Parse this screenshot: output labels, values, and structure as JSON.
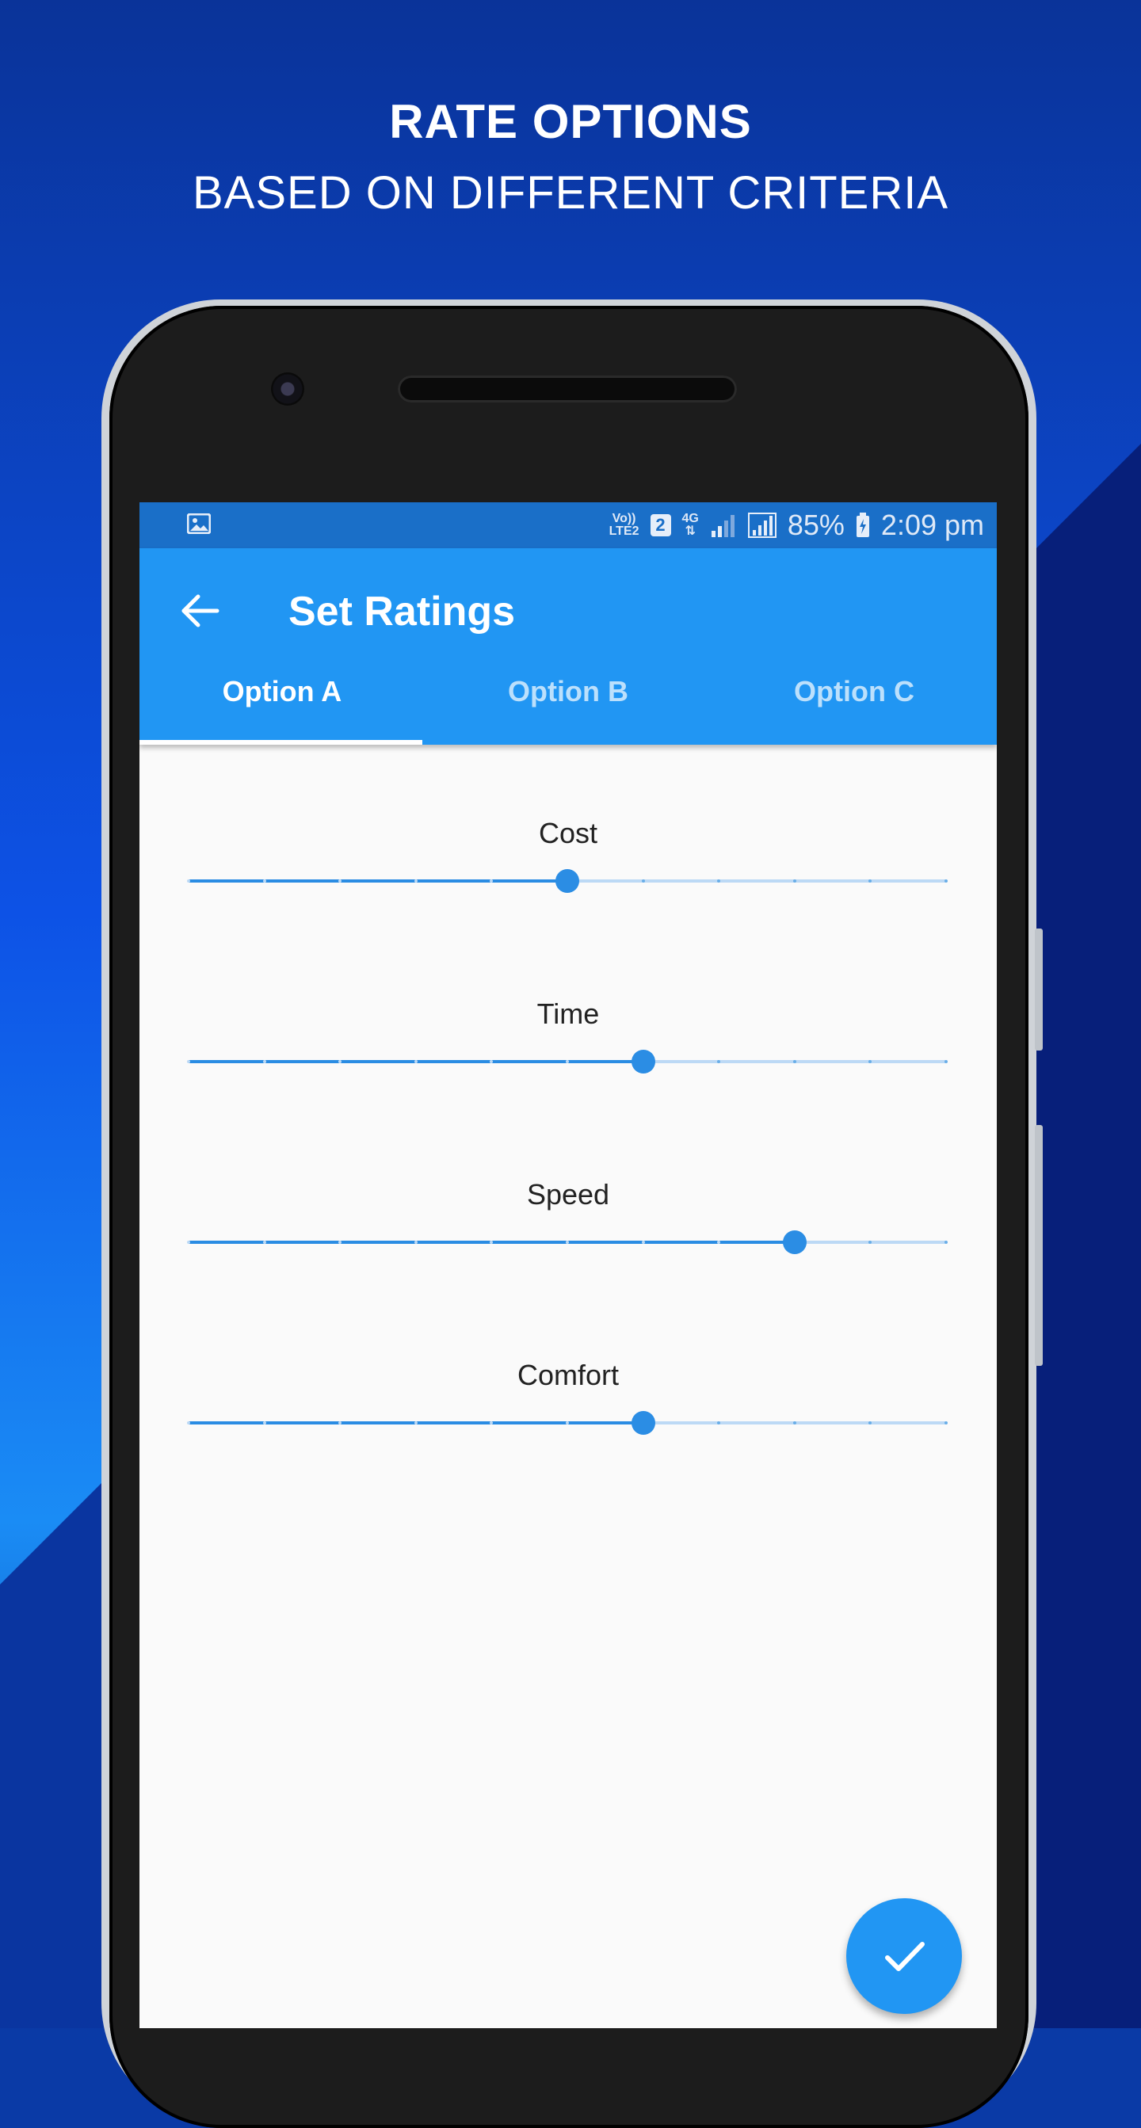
{
  "promo": {
    "headline": "RATE OPTIONS",
    "subheadline": "BASED ON DIFFERENT CRITERIA"
  },
  "status_bar": {
    "volte": "Vo))",
    "lte": "LTE2",
    "sim_badge": "2",
    "network": "4G",
    "battery": "85%",
    "time": "2:09 pm"
  },
  "app_bar": {
    "title": "Set Ratings",
    "back_icon": "arrow-left-icon"
  },
  "tabs": [
    {
      "label": "Option A",
      "selected": true
    },
    {
      "label": "Option B",
      "selected": false
    },
    {
      "label": "Option C",
      "selected": false
    }
  ],
  "sliders": [
    {
      "label": "Cost",
      "value": 5,
      "min": 0,
      "max": 10
    },
    {
      "label": "Time",
      "value": 6,
      "min": 0,
      "max": 10
    },
    {
      "label": "Speed",
      "value": 8,
      "min": 0,
      "max": 10
    },
    {
      "label": "Comfort",
      "value": 6,
      "min": 0,
      "max": 10
    }
  ],
  "fab": {
    "icon": "check-icon"
  },
  "colors": {
    "primary": "#2196f3",
    "status_bar": "#1a6fc8",
    "slider_active": "#2a8ce3",
    "slider_inactive": "#bcd9f5",
    "background_dark": "#0a3aa6"
  }
}
